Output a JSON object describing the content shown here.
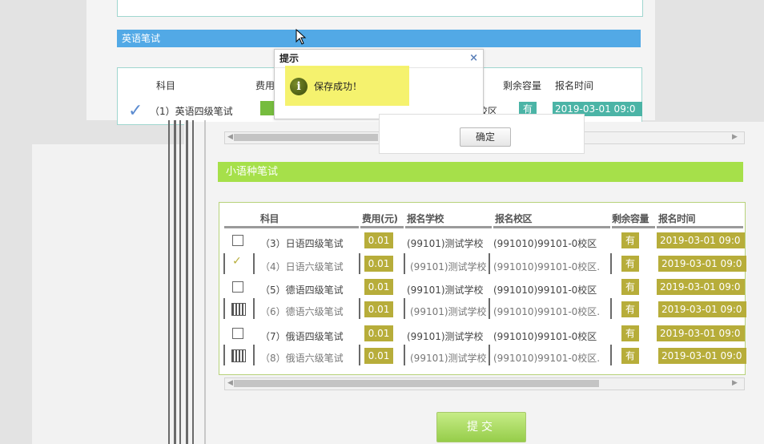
{
  "background_page": {
    "section_title": "英语笔试",
    "headers": {
      "subject": "科目",
      "fee": "费用",
      "stock": "剩余容量",
      "time": "报名时间"
    },
    "row": {
      "name": "（1）英语四级笔试",
      "campus": "校区",
      "stock": "有",
      "time": "2019-03-01 09:0"
    }
  },
  "dialog": {
    "title": "提示",
    "close": "×",
    "message": "保存成功！",
    "icon": "i",
    "ok_label": "确定"
  },
  "main": {
    "section_title": "小语种笔试",
    "headers": {
      "subject": "科目",
      "fee": "费用(元)",
      "school": "报名学校",
      "campus": "报名校区",
      "stock": "剩余容量",
      "time": "报名时间"
    },
    "rows": [
      {
        "name": "（3）日语四级笔试",
        "fee": "0.01",
        "school": "(99101)测试学校",
        "campus": "(991010)99101-0校区",
        "stock": "有",
        "time": "2019-03-01 09:0",
        "checked": false
      },
      {
        "name": "（4）日语六级笔试",
        "fee": "0.01",
        "school": "(99101)测试学校",
        "campus": "(991010)99101-0校区.",
        "stock": "有",
        "time": "2019-03-01 09:0",
        "checked": true
      },
      {
        "name": "（5）德语四级笔试",
        "fee": "0.01",
        "school": "(99101)测试学校",
        "campus": "(991010)99101-0校区",
        "stock": "有",
        "time": "2019-03-01 09:0",
        "checked": false
      },
      {
        "name": "（6）德语六级笔试",
        "fee": "0.01",
        "school": "(99101)测试学校",
        "campus": "(991010)99101-0校区.",
        "stock": "有",
        "time": "2019-03-01 09:0",
        "checked": false
      },
      {
        "name": "（7）俄语四级笔试",
        "fee": "0.01",
        "school": "(99101)测试学校",
        "campus": "(991010)99101-0校区",
        "stock": "有",
        "time": "2019-03-01 09:0",
        "checked": false
      },
      {
        "name": "（8）俄语六级笔试",
        "fee": "0.01",
        "school": "(99101)测试学校",
        "campus": "(991010)99101-0校区.",
        "stock": "有",
        "time": "2019-03-01 09:0",
        "checked": false
      }
    ],
    "submit_label": "提交"
  },
  "colors": {
    "section_blue": "#52a9e6",
    "section_green": "#a6e04a",
    "cell_olive": "#b7ad3a",
    "dialog_highlight": "#f4f05a"
  },
  "icons": [
    "info-icon",
    "close-icon",
    "checkbox-icon",
    "check-icon",
    "scroll-left-icon",
    "scroll-right-icon",
    "mouse-cursor-icon"
  ]
}
